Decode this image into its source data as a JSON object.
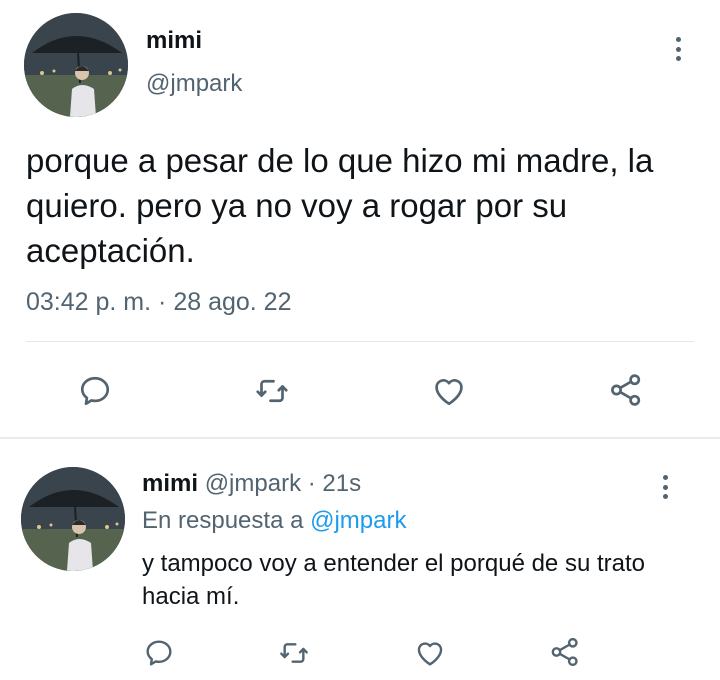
{
  "tweet": {
    "author_name": "mimi",
    "author_handle": "@jmpark",
    "text": "porque a pesar de lo que hizo mi madre, la quiero. pero ya no voy a rogar por su aceptación.",
    "time": "03:42 p. m.",
    "separator": "·",
    "date": "28 ago. 22"
  },
  "reply": {
    "author_name": "mimi",
    "author_handle": "@jmpark",
    "separator": "·",
    "age": "21s",
    "replying_prefix": "En respuesta a",
    "replying_handle": "@jmpark",
    "text": "y tampoco voy a entender el porqué de su trato hacia mí."
  },
  "icons": [
    "more-vertical-icon",
    "reply-icon",
    "retweet-icon",
    "like-icon",
    "share-icon"
  ],
  "colors": {
    "text": "#0f1419",
    "muted": "#536471",
    "link": "#1d9bf0",
    "divider": "#e3e7ea"
  }
}
